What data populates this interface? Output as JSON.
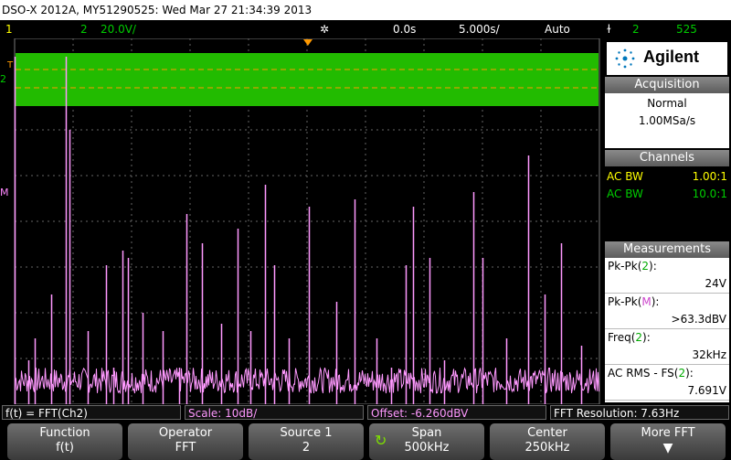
{
  "title": "DSO-X 2012A, MY51290525: Wed Mar 27 21:34:39 2013",
  "status": {
    "ch1": "1",
    "ch2": "2",
    "ch2_scale": "20.0V/",
    "time_offset": "0.0s",
    "time_scale": "5.000s/",
    "trigger_mode": "Auto",
    "trigger_source": "2",
    "trigger_level": "525"
  },
  "markers": {
    "trigger": "T",
    "ch2": "2",
    "math": "M"
  },
  "colors": {
    "ch1": "#ffff00",
    "ch2": "#00cc00",
    "math": "#ff88ff",
    "trace": "#ff99ff"
  },
  "side": {
    "brand": "Agilent",
    "acquisition": {
      "header": "Acquisition",
      "mode": "Normal",
      "rate": "1.00MSa/s"
    },
    "channels": {
      "header": "Channels",
      "rows": [
        {
          "coupling": "AC BW",
          "probe": "1.00:1"
        },
        {
          "coupling": "AC BW",
          "probe": "10.0:1"
        }
      ]
    },
    "measurements": {
      "header": "Measurements",
      "items": [
        {
          "label": "Pk-Pk(",
          "ch": "2",
          "tail": "):",
          "value": "24V"
        },
        {
          "label": "Pk-Pk(",
          "ch": "M",
          "tail": "):",
          "value": ">63.3dBV"
        },
        {
          "label": "Freq(",
          "ch": "2",
          "tail": "):",
          "value": "32kHz"
        },
        {
          "label": "AC RMS - FS(",
          "ch": "2",
          "tail": "):",
          "value": "7.691V"
        }
      ]
    }
  },
  "bottom_status": {
    "func": "f(t) = FFT(Ch2)",
    "scale": "Scale: 10dB/",
    "offset": "Offset: -6.260dBV",
    "res": "FFT Resolution: 7.63Hz"
  },
  "softkeys": [
    {
      "label": "Function",
      "value": "f(t)"
    },
    {
      "label": "Operator",
      "value": "FFT"
    },
    {
      "label": "Source 1",
      "value": "2"
    },
    {
      "label": "Span",
      "value": "500kHz"
    },
    {
      "label": "Center",
      "value": "250kHz"
    },
    {
      "label": "More FFT",
      "value": ""
    }
  ],
  "chart_data": {
    "type": "line",
    "title": "",
    "ylabel": "",
    "xlabel": "",
    "series": [
      {
        "name": "f(t) = FFT(Ch2)",
        "x": [
          0,
          15,
          22,
          40,
          56,
          60,
          80,
          100,
          108,
          118,
          124,
          140,
          162,
          180,
          188,
          205,
          226,
          244,
          258,
          274,
          284,
          300,
          322,
          352,
          372,
          396,
          412,
          428,
          436,
          454,
          470,
          502,
          512,
          538,
          562,
          580,
          598,
          620
        ],
        "y": [
          -5,
          -88,
          -82,
          -70,
          -5,
          -25,
          -80,
          -62,
          -90,
          -58,
          -60,
          -75,
          -80,
          -90,
          -48,
          -56,
          -78,
          -52,
          -80,
          -40,
          -62,
          -82,
          -46,
          -72,
          -44,
          -82,
          -90,
          -62,
          -46,
          -60,
          -88,
          -42,
          -60,
          -82,
          -32,
          -70,
          -56,
          -84
        ]
      }
    ],
    "xlim": [
      0,
      640
    ],
    "ylim": [
      -100,
      0
    ],
    "grid": true
  }
}
